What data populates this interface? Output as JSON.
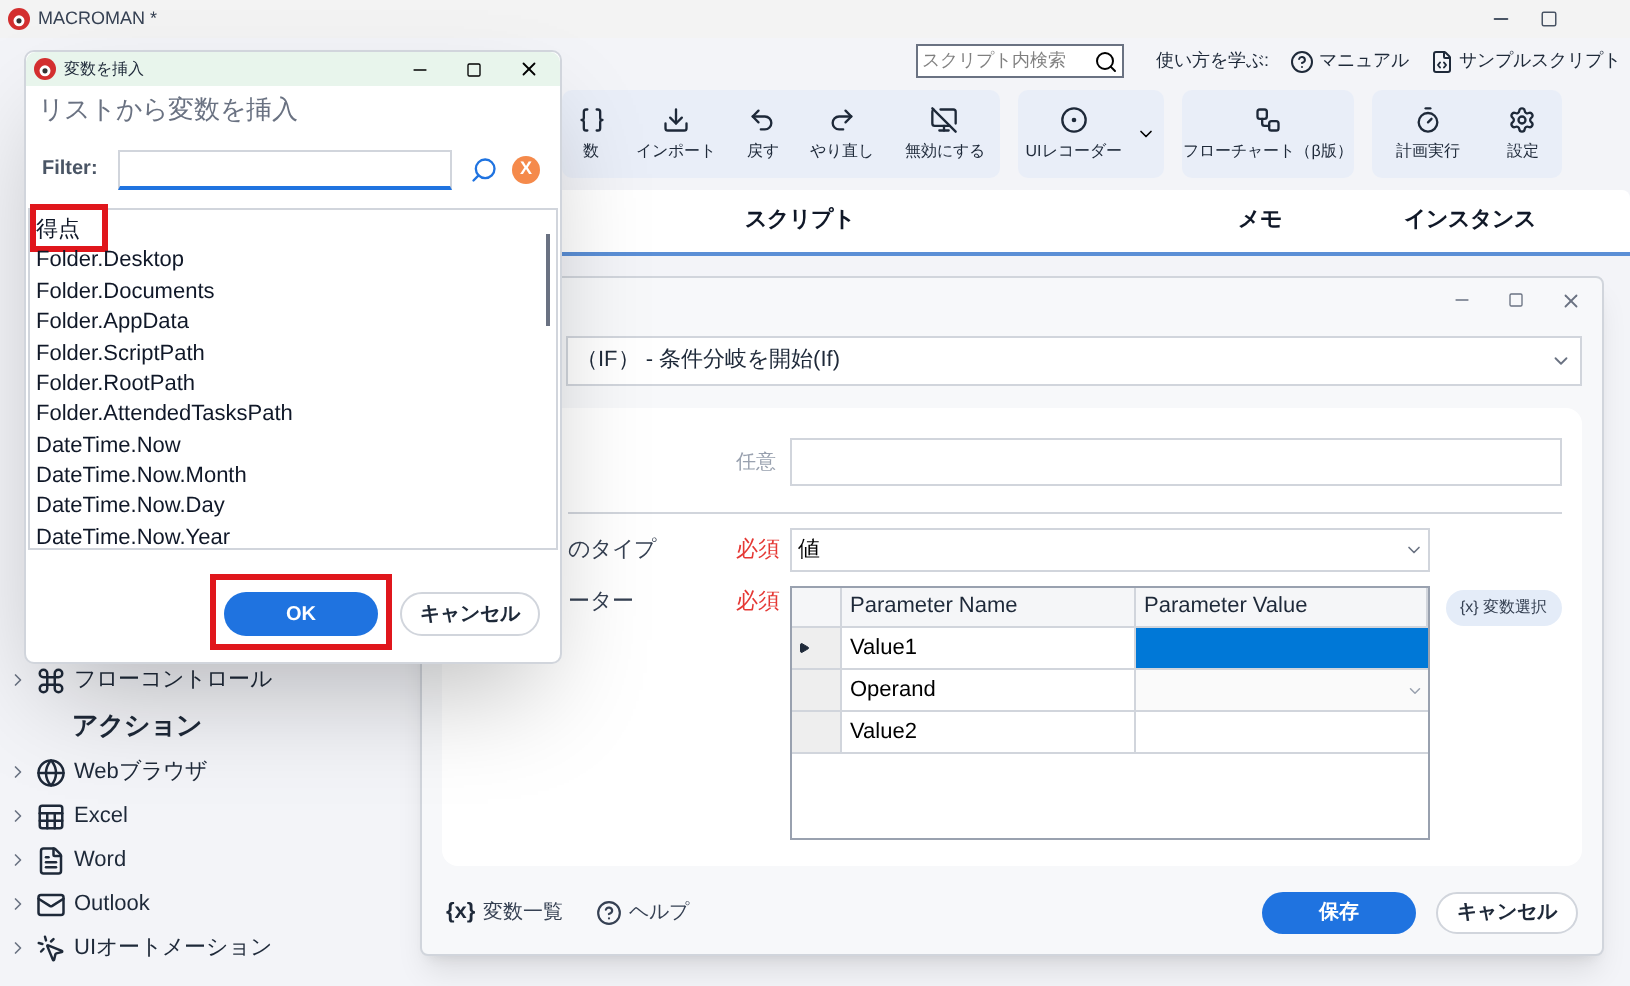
{
  "app": {
    "title": "MACROMAN *"
  },
  "header": {
    "search_placeholder": "スクリプト内検索",
    "learn_label": "使い方を学ぶ:",
    "links": [
      "マニュアル",
      "サンプルスクリプト"
    ]
  },
  "toolbar": {
    "groups": [
      {
        "buttons": [
          "数",
          "インポート",
          "戻す",
          "やり直し",
          "無効にする"
        ],
        "has_menu": false
      },
      {
        "buttons": [
          "UIレコーダー"
        ],
        "has_menu": true
      },
      {
        "buttons": [
          "フローチャート（β版）"
        ],
        "has_menu": false
      },
      {
        "buttons": [
          "計画実行",
          "設定"
        ],
        "has_menu": false
      }
    ]
  },
  "script_table": {
    "columns": [
      "スクリプト",
      "メモ",
      "インスタンス"
    ]
  },
  "sidebar": {
    "items": [
      {
        "label": "フローコントロール",
        "expanded": false
      }
    ],
    "section": "アクション",
    "actions": [
      {
        "label": "Webブラウザ",
        "expanded": false
      },
      {
        "label": "Excel",
        "expanded": false
      },
      {
        "label": "Word",
        "expanded": false
      },
      {
        "label": "Outlook",
        "expanded": false
      },
      {
        "label": "UIオートメーション",
        "expanded": false
      }
    ]
  },
  "edit_dialog": {
    "action_select": "（IF） - 条件分岐を開始(If)",
    "optional_badge": "任意",
    "type_field": {
      "label": "のタイプ",
      "badge": "必須",
      "value": "値"
    },
    "params": {
      "label": "ーター",
      "badge": "必須",
      "columns": [
        "Parameter Name",
        "Parameter Value"
      ],
      "rows": [
        {
          "name": "Value1",
          "kind": "text",
          "selected": true
        },
        {
          "name": "Operand",
          "kind": "dropdown",
          "selected": false
        },
        {
          "name": "Value2",
          "kind": "text",
          "selected": false
        }
      ],
      "variable_button": "{x} 変数選択"
    },
    "footer_links": [
      {
        "icon_text": "{x}",
        "label": "変数一覧"
      },
      {
        "label": "ヘルプ"
      }
    ],
    "buttons": [
      {
        "label": "保存",
        "primary": true
      },
      {
        "label": "キャンセル",
        "primary": false
      }
    ]
  },
  "insert_dialog": {
    "title": "変数を挿入",
    "heading": "リストから変数を挿入",
    "filter_label": "Filter:",
    "clear_label": "X",
    "items": [
      {
        "text": "得点",
        "highlighted": true
      },
      {
        "text": "Folder.Desktop",
        "highlighted": false
      },
      {
        "text": "Folder.Documents",
        "highlighted": false
      },
      {
        "text": "Folder.AppData",
        "highlighted": false
      },
      {
        "text": "Folder.ScriptPath",
        "highlighted": false
      },
      {
        "text": "Folder.RootPath",
        "highlighted": false
      },
      {
        "text": "Folder.AttendedTasksPath",
        "highlighted": false
      },
      {
        "text": "DateTime.Now",
        "highlighted": false
      },
      {
        "text": "DateTime.Now.Month",
        "highlighted": false
      },
      {
        "text": "DateTime.Now.Day",
        "highlighted": false
      },
      {
        "text": "DateTime.Now.Year",
        "highlighted": false
      }
    ],
    "buttons": [
      {
        "label": "OK",
        "primary": true,
        "highlighted": true
      },
      {
        "label": "キャンセル",
        "primary": false,
        "highlighted": false
      }
    ]
  }
}
